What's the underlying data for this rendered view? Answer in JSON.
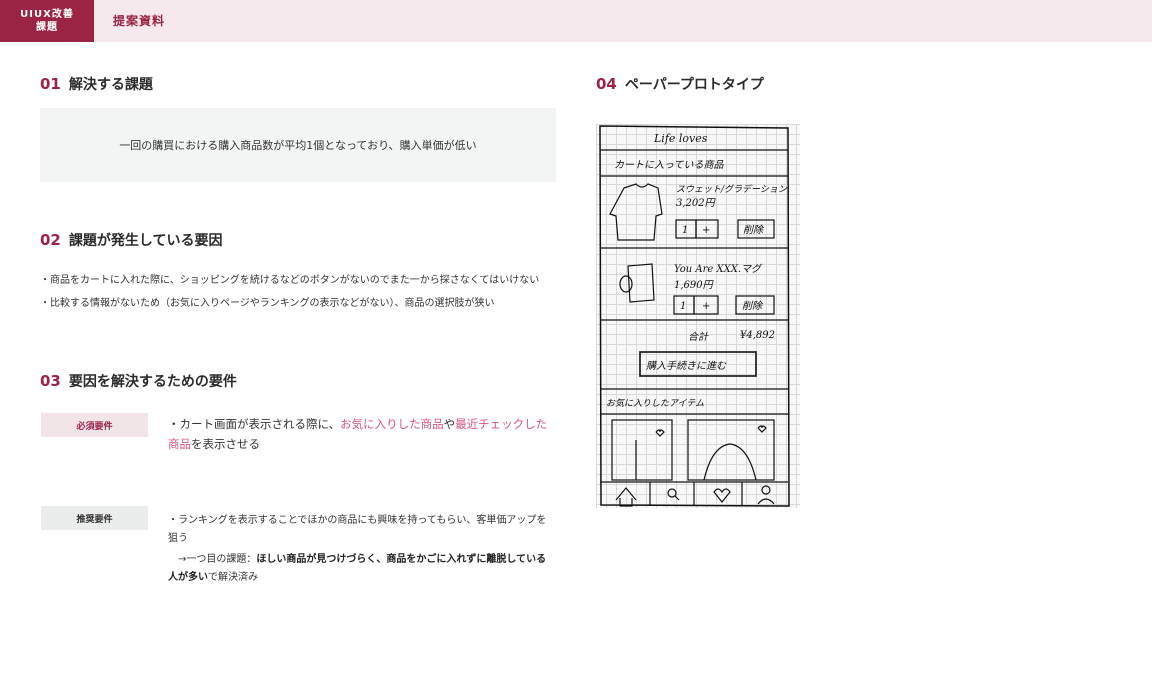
{
  "header": {
    "badge_line1": "UIUX改善",
    "badge_line2": "課題",
    "title": "提案資料"
  },
  "sections": {
    "s1": {
      "num": "01",
      "title": "解決する課題",
      "problem": "一回の購買における購入商品数が平均1個となっており、購入単価が低い"
    },
    "s2": {
      "num": "02",
      "title": "課題が発生している要因",
      "causes": [
        "・商品をカートに入れた際に、ショッピングを続けるなどのボタンがないのでまた一から探さなくてはいけない",
        "・比較する情報がないため（お気に入りページやランキングの表示などがない）、商品の選択肢が狭い"
      ]
    },
    "s3": {
      "num": "03",
      "title": "要因を解決するための要件",
      "must_label": "必須要件",
      "must_pre": "・カート画面が表示される際に、",
      "must_hl1": "お気に入りした商品",
      "must_mid": "や",
      "must_hl2": "最近チェックした商品",
      "must_post": "を表示させる",
      "rec_label": "推奨要件",
      "rec_text": "・ランキングを表示することでほかの商品にも興味を持ってもらい、客単価アップを狙う",
      "rec_prefix": "　→一つ目の課題：",
      "rec_bold": "ほしい商品が見つけづらく、商品をかごに入れずに離脱している人が多い",
      "rec_suffix": "で解決済み"
    },
    "s4": {
      "num": "04",
      "title": "ペーパープロトタイプ"
    }
  },
  "sketch": {
    "app_name": "Life loves",
    "cart_title": "カートに入っている商品",
    "item1_name": "スウェット/グラデーション",
    "item1_price": "3,202円",
    "item2_name": "You Are XXX.マグ",
    "item2_price": "1,690円",
    "qty": "1",
    "plus": "+",
    "delete": "削除",
    "total_label": "合計",
    "total_value": "¥4,892",
    "checkout": "購入手続きに進む",
    "favorites": "お気に入りしたアイテム"
  }
}
